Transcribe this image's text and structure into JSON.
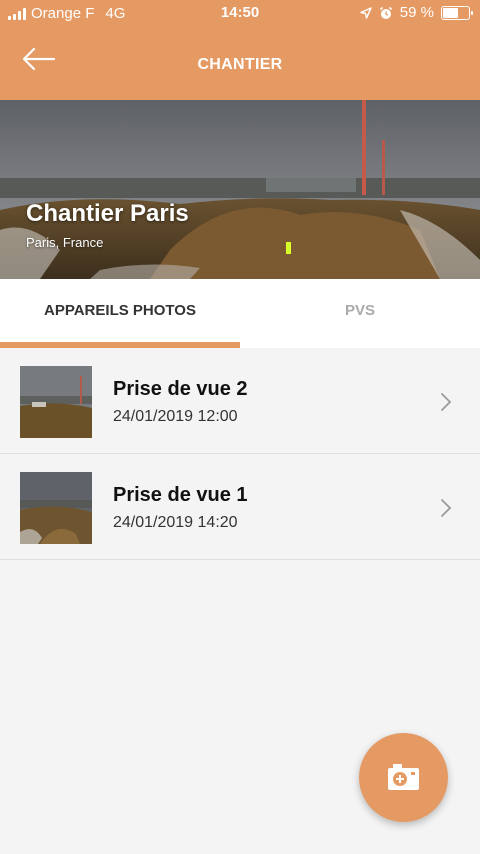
{
  "status_bar": {
    "carrier": "Orange F",
    "network": "4G",
    "time": "14:50",
    "battery_text": "59 %",
    "battery_level": 0.59
  },
  "header": {
    "title": "CHANTIER",
    "back_icon": "arrow-left-icon"
  },
  "site": {
    "name": "Chantier Paris",
    "location": "Paris, France"
  },
  "tabs": [
    {
      "label": "APPAREILS PHOTOS",
      "active": true
    },
    {
      "label": "PVS",
      "active": false
    }
  ],
  "cameras": [
    {
      "title": "Prise de vue 2",
      "date": "24/01/2019 12:00"
    },
    {
      "title": "Prise de vue 1",
      "date": "24/01/2019 14:20"
    }
  ],
  "fab": {
    "icon": "add-photo-icon"
  },
  "colors": {
    "accent": "#e59a63",
    "background": "#f4f4f4"
  }
}
